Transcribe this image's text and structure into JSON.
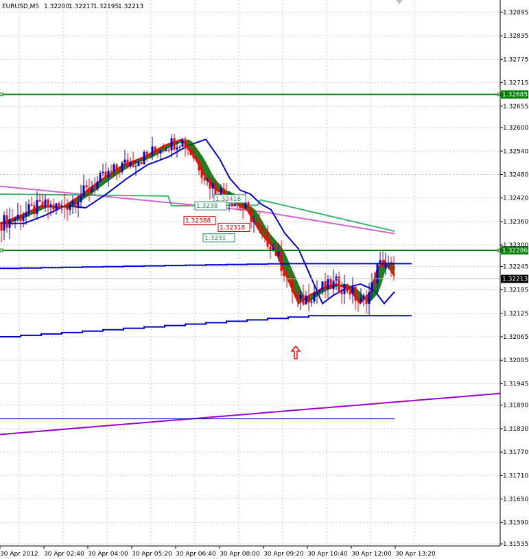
{
  "chart_data": {
    "type": "candlestick",
    "symbol_header": "EURUSD,M5",
    "ohlc_header": {
      "open": "1.32200",
      "high": "1.32217",
      "low": "1.32195",
      "close": "1.32213"
    },
    "ylim": [
      1.31535,
      1.32925
    ],
    "y_ticks": [
      "1.32895",
      "1.32835",
      "1.32775",
      "1.32715",
      "1.32655",
      "1.32600",
      "1.32540",
      "1.32480",
      "1.32420",
      "1.32360",
      "1.32300",
      "1.32245",
      "1.32185",
      "1.32125",
      "1.32065",
      "1.32005",
      "1.31945",
      "1.31890",
      "1.31830",
      "1.31770",
      "1.31710",
      "1.31650",
      "1.31590",
      "1.31535"
    ],
    "x_ticks": [
      "30 Apr 2012",
      "30 Apr 02:40",
      "30 Apr 04:00",
      "30 Apr 05:20",
      "30 Apr 06:40",
      "30 Apr 08:00",
      "30 Apr 09:20",
      "30 Apr 10:40",
      "30 Apr 12:00",
      "30 Apr 13:20"
    ],
    "grid": true,
    "colors": {
      "bull": "#0000cc",
      "bear": "#ff0000",
      "grid": "#c8c8c8",
      "hline": "#008000",
      "ma_blue": "#0000cc",
      "ma_green": "#3cb371",
      "ma_violet": "#cc66cc",
      "trend": "#9900cc",
      "cloud_bull": "#006400",
      "cloud_bear": "#550000",
      "arrow": "#ff0000"
    },
    "horizontal_levels": [
      {
        "price": 1.32685,
        "label": "1.32685",
        "color": "#008000"
      },
      {
        "price": 1.32286,
        "label": "1.32286",
        "color": "#008000"
      }
    ],
    "current_price": {
      "price": 1.32213,
      "label": "1.32213"
    },
    "price_tags": [
      {
        "text": "1.32418"
      },
      {
        "text": "1.3238"
      },
      {
        "text": "1.32388"
      },
      {
        "text": "1.32318"
      },
      {
        "text": "1.3231"
      }
    ],
    "signal_arrow": {
      "direction": "up",
      "price": 1.3203
    }
  }
}
